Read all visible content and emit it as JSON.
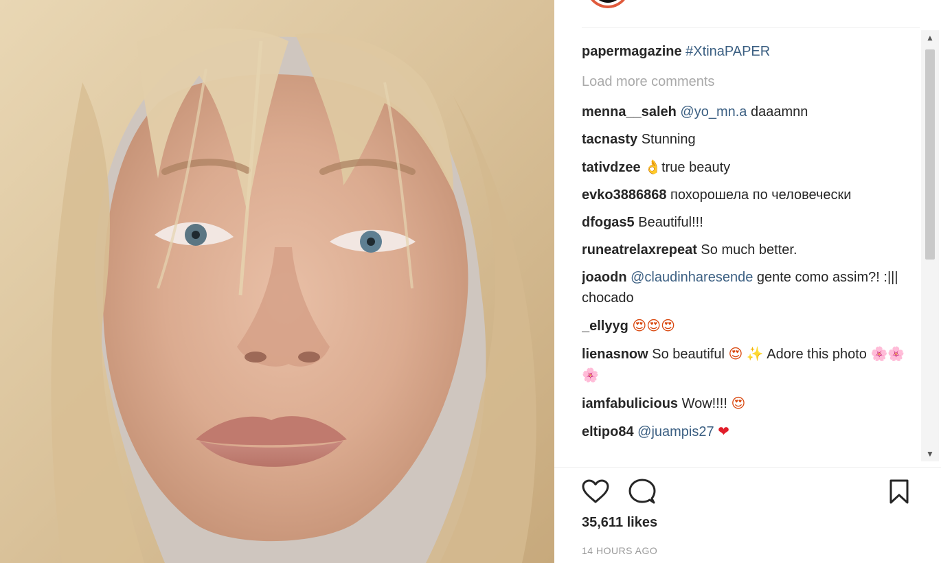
{
  "post": {
    "caption": {
      "username": "papermagazine",
      "hashtag": "#XtinaPAPER"
    },
    "load_more_label": "Load more comments",
    "comments": [
      {
        "username": "menna__saleh",
        "mention": "@yo_mn.a",
        "text": " daaamnn"
      },
      {
        "username": "tacnasty",
        "text": " Stunning"
      },
      {
        "username": "tativdzee",
        "emoji_1": "👌",
        "text": "true beauty"
      },
      {
        "username": "evko3886868",
        "text": " похорошела по человечески"
      },
      {
        "username": "dfogas5",
        "text": " Beautiful!!!"
      },
      {
        "username": "runeatrelaxrepeat",
        "text": " So much better."
      },
      {
        "username": "joaodn",
        "mention": "@claudinharesende",
        "text": " gente como assim?! :||| chocado"
      },
      {
        "username": "_ellyyg",
        "emoji_1": "😍😍😍"
      },
      {
        "username": "lienasnow",
        "text": " So beautiful ",
        "emoji_1": "😍",
        "emoji_2": "✨",
        "text_2": " Adore this photo ",
        "emoji_3": "🌸🌸🌸"
      },
      {
        "username": "iamfabulicious",
        "text": " Wow!!!! ",
        "emoji_1": "😍"
      },
      {
        "username": "eltipo84",
        "mention": "@juampis27",
        "emoji_1": "❤"
      }
    ],
    "likes_label": "35,611 likes",
    "time_label": "14 HOURS AGO"
  },
  "icons": {
    "like": "heart-outline-icon",
    "comment": "speech-bubble-icon",
    "save": "bookmark-icon",
    "scroll_up": "▲",
    "scroll_down": "▼"
  },
  "colors": {
    "username": "#262626",
    "link": "#3b5f82",
    "muted": "#a9a9a9",
    "avatar_ring": "#e05a3c"
  }
}
